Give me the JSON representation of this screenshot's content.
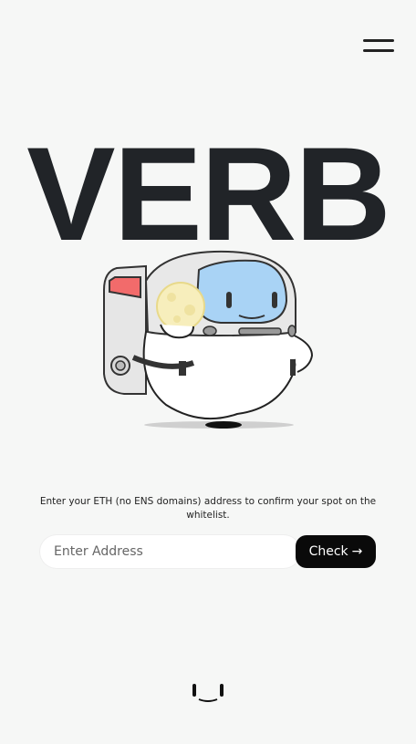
{
  "header": {
    "menu_icon": "hamburger-menu-icon"
  },
  "hero": {
    "title": "VERB"
  },
  "mascot": {
    "icon": "astronaut-mascot-illustration"
  },
  "whitelist": {
    "instructions": "Enter your ETH (no ENS domains) address to confirm your spot on the whitelist.",
    "input_placeholder": "Enter Address",
    "input_value": "",
    "check_label": "Check",
    "check_arrow": "→"
  },
  "footer": {
    "logo_icon": "verb-face-logo-icon"
  },
  "colors": {
    "background": "#f6f7f6",
    "title": "#212428",
    "button": "#0a0a0a"
  }
}
